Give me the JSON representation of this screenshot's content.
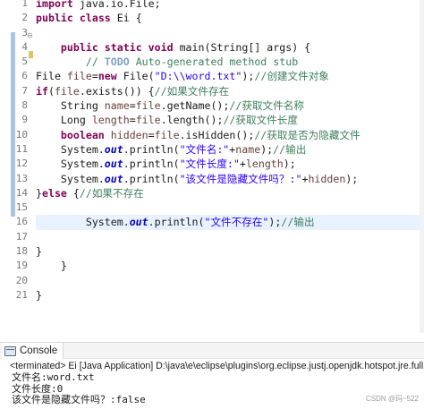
{
  "editor": {
    "line_numbers": [
      "1",
      "2",
      "3",
      "4",
      "5",
      "6",
      "7",
      "8",
      "9",
      "10",
      "11",
      "12",
      "13",
      "14",
      "15",
      "16",
      "17",
      "18",
      "19",
      "20",
      "21"
    ],
    "fold_marker": "⊖",
    "code": {
      "l1_kw": "import",
      "l1_rest": " java.io.File;",
      "l2_kw1": "public",
      "l2_kw2": "class",
      "l2_rest": " Ei {",
      "l4_kw1": "public",
      "l4_kw2": "static",
      "l4_kw3": "void",
      "l4_rest": " main(String[] args) {",
      "l5_comment": "// ",
      "l5_todo": "TODO",
      "l5_comment_rest": " Auto-generated method stub",
      "l6_pre": "File ",
      "l6_var": "file",
      "l6_eq": "=",
      "l6_kw": "new",
      "l6_mid": " File(",
      "l6_str": "\"D:\\\\word.txt\"",
      "l6_end": ");",
      "l6_comment": "//创建文件对象",
      "l7_kw": "if",
      "l7_mid": "(",
      "l7_var": "file",
      "l7_rest": ".exists()) {",
      "l7_comment": "//如果文件存在",
      "l8_pre": "    String ",
      "l8_var1": "name",
      "l8_eq": "=",
      "l8_var2": "file",
      "l8_rest": ".getName();",
      "l8_comment": "//获取文件名称",
      "l9_pre": "    Long ",
      "l9_var1": "length",
      "l9_eq": "=",
      "l9_var2": "file",
      "l9_rest": ".length();",
      "l9_comment": "//获取文件长度",
      "l10_kw": "    boolean",
      "l10_sp": " ",
      "l10_var1": "hidden",
      "l10_eq": "=",
      "l10_var2": "file",
      "l10_rest": ".isHidden();",
      "l10_comment": "//获取是否为隐藏文件",
      "l11_pre": "    System.",
      "l11_fld": "out",
      "l11_mid": ".println(",
      "l11_str": "\"文件名:\"",
      "l11_plus": "+",
      "l11_var": "name",
      "l11_end": ");",
      "l11_comment": "//输出",
      "l12_pre": "    System.",
      "l12_fld": "out",
      "l12_mid": ".println(",
      "l12_str": "\"文件长度:\"",
      "l12_plus": "+",
      "l12_var": "length",
      "l12_end": ");",
      "l13_pre": "    System.",
      "l13_fld": "out",
      "l13_mid": ".println(",
      "l13_str": "\"该文件是隐藏文件吗？:\"",
      "l13_plus": "+",
      "l13_var": "hidden",
      "l13_end": ");",
      "l14_pre": "}",
      "l14_kw": "else",
      "l14_mid": " {",
      "l14_comment": "//如果不存在",
      "l16_pre": "        System.",
      "l16_fld": "out",
      "l16_mid": ".println(",
      "l16_str": "\"文件不存在\"",
      "l16_end": ");",
      "l16_comment": "//输出",
      "l18": "}",
      "l19": "    }",
      "l21": "}"
    }
  },
  "console": {
    "tab_label": "Console",
    "status": "<terminated> Ei [Java Application] D:\\java\\e\\eclipse\\plugins\\org.eclipse.justj.openjdk.hotspot.jre.full.w",
    "output": [
      "文件名:word.txt",
      "文件长度:0",
      "该文件是隐藏文件吗？:false"
    ]
  },
  "watermark": "CSDN @玛~522",
  "colors": {
    "keyword": "#7f0055",
    "comment": "#3f7f5f",
    "string": "#2a00ff",
    "field": "#0000c0",
    "current_line": "#e8f2fe",
    "change_bar": "#a9c4e8"
  }
}
